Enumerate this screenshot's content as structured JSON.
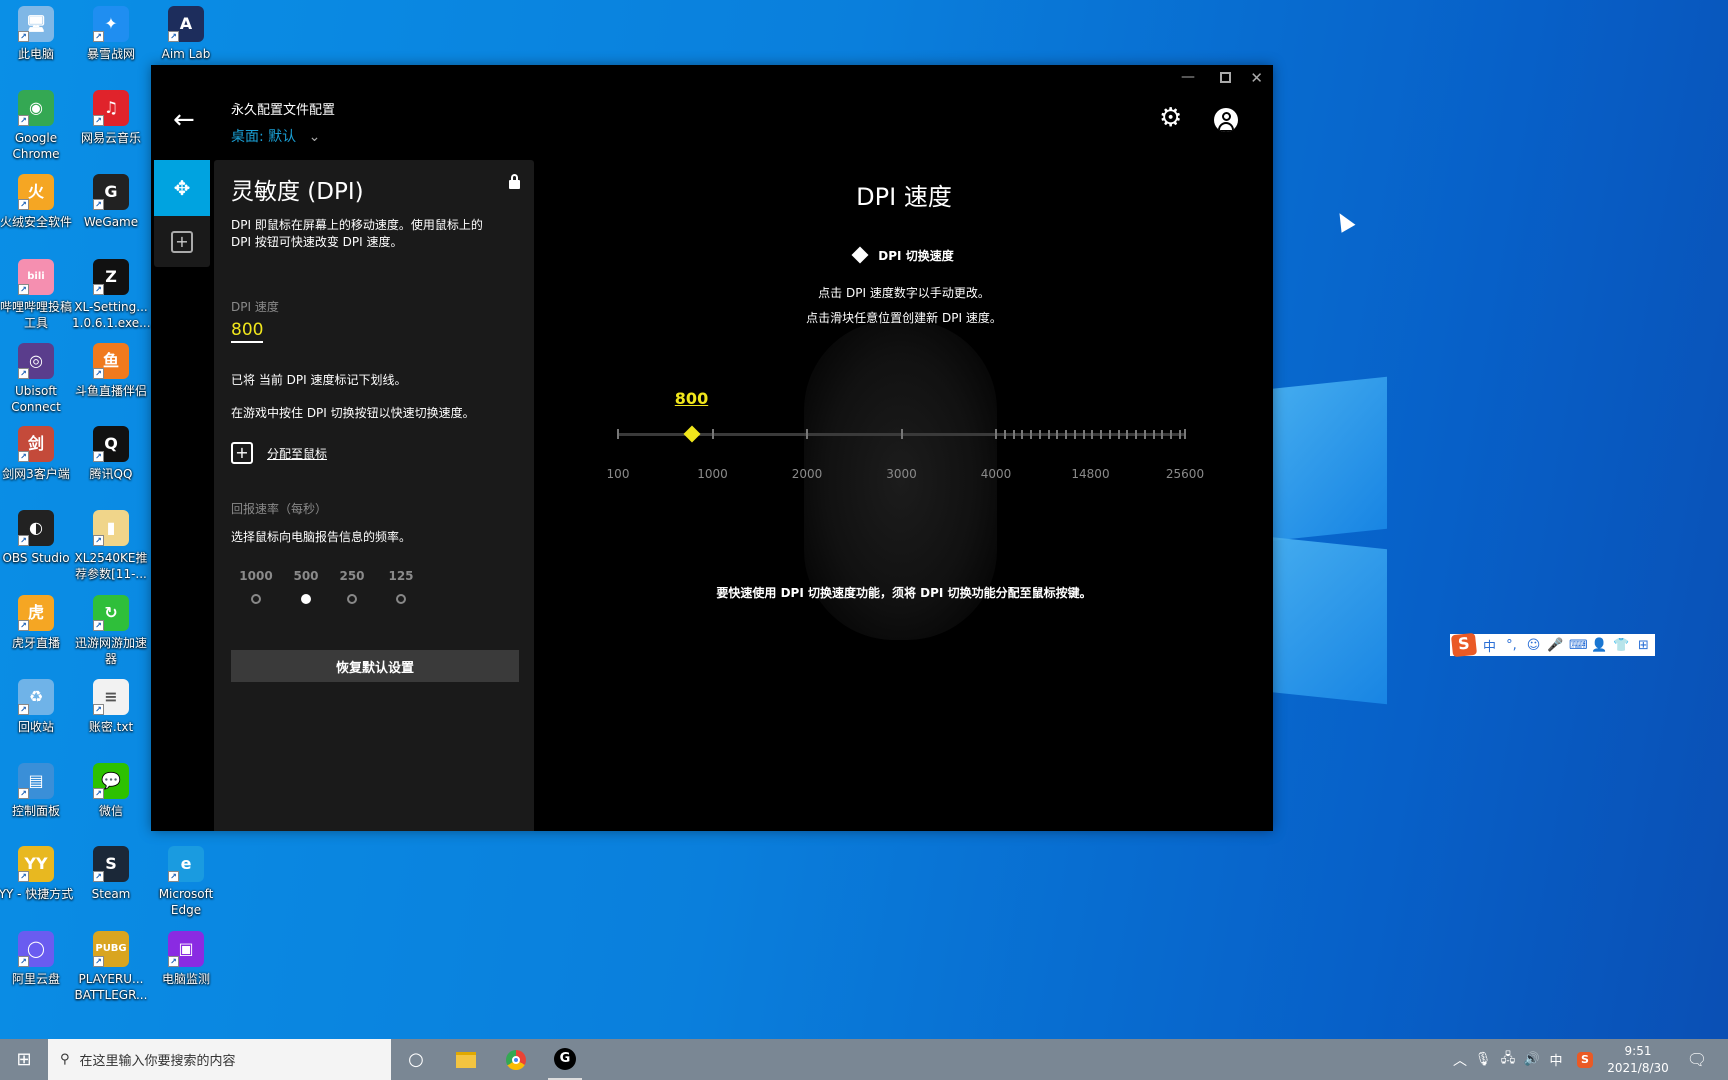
{
  "desktop": {
    "icons": [
      {
        "label": "此电脑",
        "glyph": "🖥",
        "color": "#7fb7e6"
      },
      {
        "label": "Google Chrome",
        "glyph": "◉",
        "color": "#34a853"
      },
      {
        "label": "火绒安全软件",
        "glyph": "火",
        "color": "#f5a623"
      },
      {
        "label": "哔哩哔哩投稿工具",
        "glyph": "bili",
        "color": "#f58fb0"
      },
      {
        "label": "Ubisoft Connect",
        "glyph": "◎",
        "color": "#5a3d8c"
      },
      {
        "label": "剑网3客户端",
        "glyph": "剑",
        "color": "#c44a3a"
      },
      {
        "label": "OBS Studio",
        "glyph": "◐",
        "color": "#222222"
      },
      {
        "label": "虎牙直播",
        "glyph": "虎",
        "color": "#f5a623"
      },
      {
        "label": "回收站",
        "glyph": "♻",
        "color": "#6fb3e8"
      },
      {
        "label": "控制面板",
        "glyph": "▤",
        "color": "#3a8fd8"
      },
      {
        "label": "YY - 快捷方式",
        "glyph": "YY",
        "color": "#e8b820"
      },
      {
        "label": "阿里云盘",
        "glyph": "◯",
        "color": "#6a5cf0"
      },
      {
        "label": "暴雪战网",
        "glyph": "✦",
        "color": "#1f8ef1"
      },
      {
        "label": "网易云音乐",
        "glyph": "♫",
        "color": "#e0232b"
      },
      {
        "label": "WeGame",
        "glyph": "G",
        "color": "#222222"
      },
      {
        "label": "XL-Setting... 1.0.6.1.exe...",
        "glyph": "Z",
        "color": "#111111"
      },
      {
        "label": "斗鱼直播伴侣",
        "glyph": "鱼",
        "color": "#f07a1e"
      },
      {
        "label": "腾讯QQ",
        "glyph": "Q",
        "color": "#111111"
      },
      {
        "label": "XL2540KE推荐参数[11-...",
        "glyph": "▮",
        "color": "#f0d58a"
      },
      {
        "label": "迅游网游加速器",
        "glyph": "↻",
        "color": "#2fbf3a"
      },
      {
        "label": "账密.txt",
        "glyph": "≡",
        "color": "#f2f2f2"
      },
      {
        "label": "微信",
        "glyph": "💬",
        "color": "#2dc100"
      },
      {
        "label": "Steam",
        "glyph": "S",
        "color": "#1b2838"
      },
      {
        "label": "PLAYERU... BATTLEGR...",
        "glyph": "PUBG",
        "color": "#d9a520"
      },
      {
        "label": "Aim Lab",
        "glyph": "A",
        "color": "#1d2d5c"
      },
      {
        "label": "Microsoft Edge",
        "glyph": "e",
        "color": "#1a9be0"
      },
      {
        "label": "电脑监测",
        "glyph": "▣",
        "color": "#8a2be2"
      }
    ]
  },
  "app": {
    "profile_title": "永久配置文件配置",
    "profile_name": "桌面: 默认",
    "accent": "#00a3e0",
    "highlight": "#f0e61c",
    "panel": {
      "title": "灵敏度 (DPI)",
      "desc1": "DPI 即鼠标在屏幕上的移动速度。使用鼠标上的",
      "desc2": "DPI 按钮可快速改变 DPI 速度。",
      "dpi_label": "DPI 速度",
      "dpi_value": "800",
      "note1": "已将 当前 DPI 速度标记下划线。",
      "note2": "在游戏中按住 DPI 切换按钮以快速切换速度。",
      "assign": "分配至鼠标",
      "rate_title": "回报速率（每秒）",
      "rate_desc": "选择鼠标向电脑报告信息的频率。",
      "rates": [
        "1000",
        "500",
        "250",
        "125"
      ],
      "rate_selected": "500",
      "reset": "恢复默认设置"
    },
    "main": {
      "title": "DPI 速度",
      "legend": "DPI 切换速度",
      "hint1": "点击 DPI 速度数字以手动更改。",
      "hint2": "点击滑块任意位置创建新 DPI 速度。",
      "slider_value": "800",
      "ticks": [
        "100",
        "1000",
        "2000",
        "3000",
        "4000",
        "14800",
        "25600"
      ],
      "footer": "要快速使用 DPI 切换速度功能，须将 DPI 切换功能分配至鼠标按键。"
    }
  },
  "ime": {
    "items": [
      "中",
      "°,",
      "☺",
      "🎤",
      "⌨",
      "👤",
      "👕",
      "⊞"
    ]
  },
  "taskbar": {
    "search_placeholder": "在这里输入你要搜索的内容",
    "time": "9:51",
    "date": "2021/8/30",
    "lang": "中"
  }
}
